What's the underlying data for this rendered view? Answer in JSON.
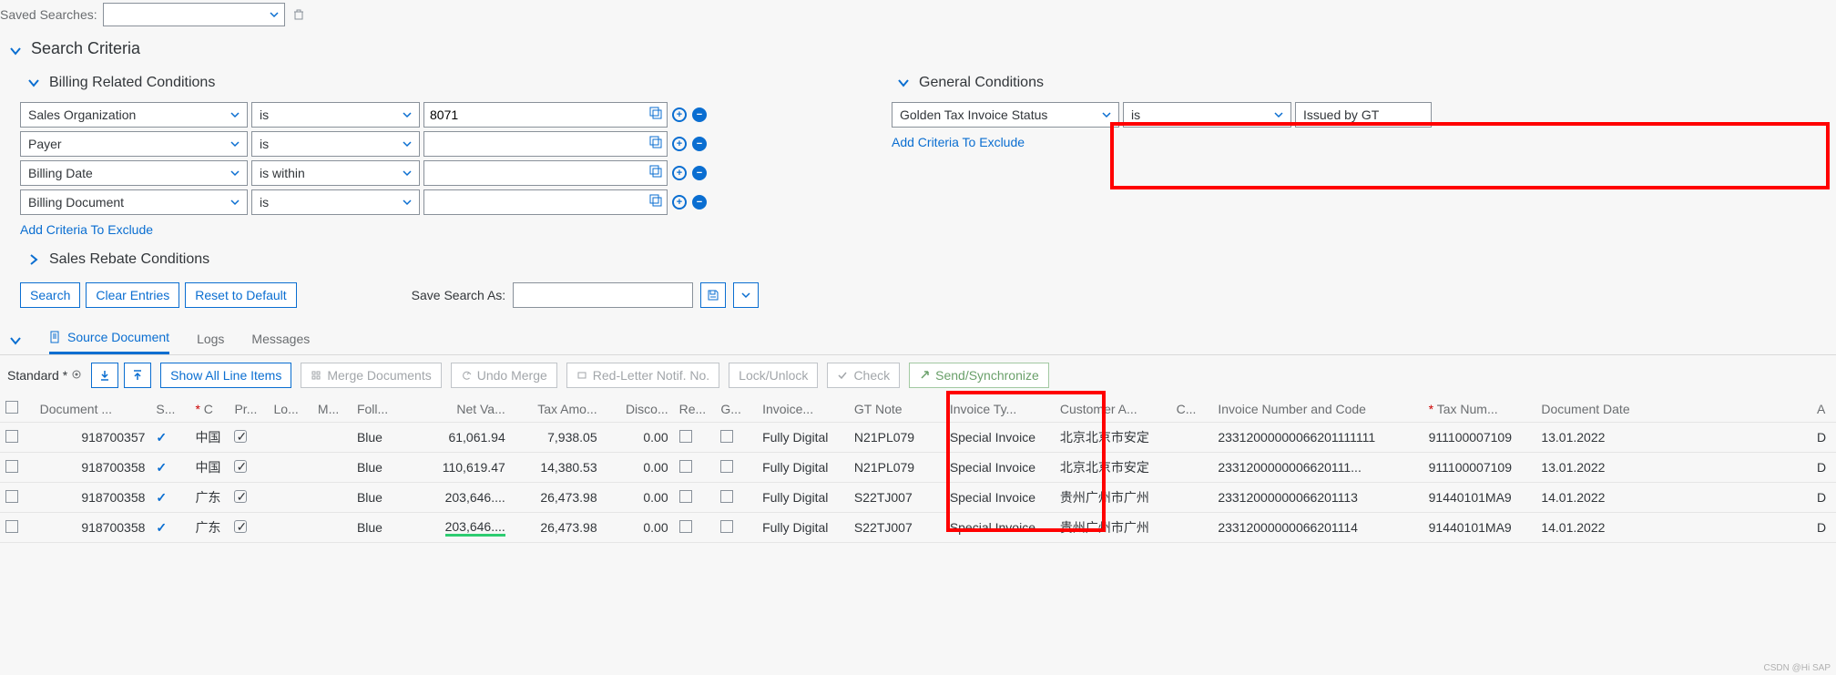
{
  "saved_searches_label": "Saved Searches:",
  "search_criteria_title": "Search Criteria",
  "billing_conditions_title": "Billing Related Conditions",
  "general_conditions_title": "General Conditions",
  "sales_rebate_title": "Sales Rebate Conditions",
  "add_criteria_exclude": "Add Criteria To Exclude",
  "billing_rows": [
    {
      "field": "Sales Organization",
      "op": "is",
      "value": "8071"
    },
    {
      "field": "Payer",
      "op": "is",
      "value": ""
    },
    {
      "field": "Billing Date",
      "op": "is within",
      "value": ""
    },
    {
      "field": "Billing Document",
      "op": "is",
      "value": ""
    }
  ],
  "general_row": {
    "field": "Golden Tax Invoice Status",
    "op": "is",
    "value": "Issued by GT"
  },
  "buttons": {
    "search": "Search",
    "clear": "Clear Entries",
    "reset": "Reset to Default",
    "save_as_label": "Save Search As:"
  },
  "tabs": {
    "source": "Source Document",
    "logs": "Logs",
    "messages": "Messages"
  },
  "toolbar": {
    "standard": "Standard *",
    "show_all": "Show All Line Items",
    "merge": "Merge Documents",
    "undo_merge": "Undo Merge",
    "red_letter": "Red-Letter Notif. No.",
    "lock": "Lock/Unlock",
    "check": "Check",
    "send": "Send/Synchronize"
  },
  "columns": {
    "doc": "Document ...",
    "s": "S...",
    "c": "* C",
    "pr": "Pr...",
    "lo": "Lo...",
    "m": "M...",
    "foll": "Foll...",
    "netval": "Net Va...",
    "tax": "Tax Amo...",
    "disc": "Disco...",
    "re": "Re...",
    "g": "G...",
    "inv": "Invoice...",
    "gtnote": "GT Note",
    "invty": "Invoice Ty...",
    "cust": "Customer A...",
    "cshort": "C...",
    "invnum": "Invoice Number and Code",
    "taxnum": "* Tax Num...",
    "docdate": "Document Date",
    "act": "A"
  },
  "rows": [
    {
      "doc": "918700357",
      "c": "中国",
      "foll": "Blue",
      "net": "61,061.94",
      "tax": "7,938.05",
      "disc": "0.00",
      "inv": "Fully Digital",
      "gt": "N21PL079",
      "ty": "Special Invoice",
      "cust": "北京北京市安定",
      "num": "23312000000066201111111",
      "taxn": "911100007109",
      "date": "13.01.2022",
      "act": "D"
    },
    {
      "doc": "918700358",
      "c": "中国",
      "foll": "Blue",
      "net": "110,619.47",
      "tax": "14,380.53",
      "disc": "0.00",
      "inv": "Fully Digital",
      "gt": "N21PL079",
      "ty": "Special Invoice",
      "cust": "北京北京市安定",
      "num": "2331200000006620111...",
      "taxn": "911100007109",
      "date": "13.01.2022",
      "act": "D"
    },
    {
      "doc": "918700358",
      "c": "广东",
      "foll": "Blue",
      "net": "203,646....",
      "tax": "26,473.98",
      "disc": "0.00",
      "inv": "Fully Digital",
      "gt": "S22TJ007",
      "ty": "Special Invoice",
      "cust": "贵州广州市广州",
      "num": "23312000000066201113",
      "taxn": "91440101MA9",
      "date": "14.01.2022",
      "act": "D"
    },
    {
      "doc": "918700358",
      "c": "广东",
      "foll": "Blue",
      "net": "203,646....",
      "tax": "26,473.98",
      "disc": "0.00",
      "inv": "Fully Digital",
      "gt": "S22TJ007",
      "ty": "Special Invoice",
      "cust": "贵州广州市广州",
      "num": "23312000000066201114",
      "taxn": "91440101MA9",
      "date": "14.01.2022",
      "act": "D",
      "green": true
    }
  ],
  "watermark": "CSDN @Hi SAP"
}
